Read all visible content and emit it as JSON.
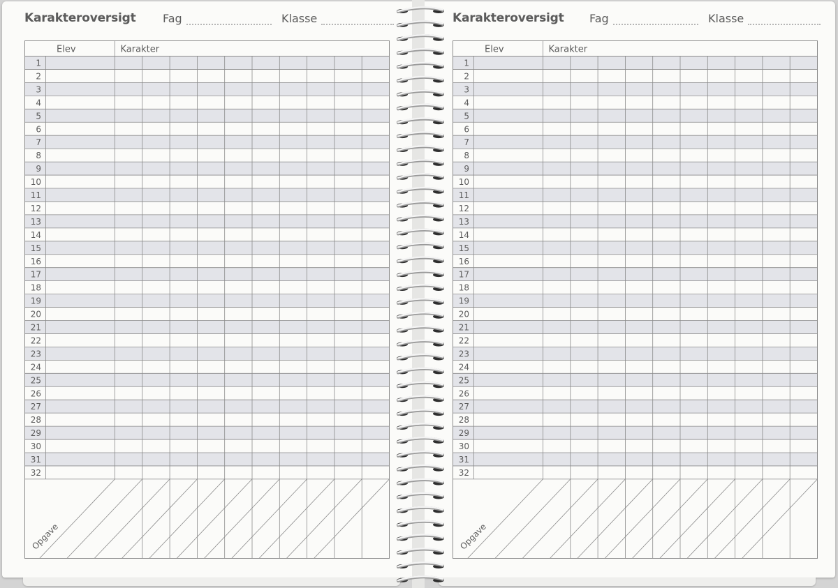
{
  "pages": [
    {
      "title": "Karakteroversigt",
      "fag_label": "Fag",
      "klasse_label": "Klasse",
      "col_elev": "Elev",
      "col_karakter": "Karakter",
      "row_numbers": [
        "1",
        "2",
        "3",
        "4",
        "5",
        "6",
        "7",
        "8",
        "9",
        "10",
        "11",
        "12",
        "13",
        "14",
        "15",
        "16",
        "17",
        "18",
        "19",
        "20",
        "21",
        "22",
        "23",
        "24",
        "25",
        "26",
        "27",
        "28",
        "29",
        "30",
        "31",
        "32"
      ],
      "opgave_label": "Opgave"
    },
    {
      "title": "Karakteroversigt",
      "fag_label": "Fag",
      "klasse_label": "Klasse",
      "col_elev": "Elev",
      "col_karakter": "Karakter",
      "row_numbers": [
        "1",
        "2",
        "3",
        "4",
        "5",
        "6",
        "7",
        "8",
        "9",
        "10",
        "11",
        "12",
        "13",
        "14",
        "15",
        "16",
        "17",
        "18",
        "19",
        "20",
        "21",
        "22",
        "23",
        "24",
        "25",
        "26",
        "27",
        "28",
        "29",
        "30",
        "31",
        "32"
      ],
      "opgave_label": "Opgave"
    }
  ],
  "colors": {
    "shaded_row": "#e3e4e9",
    "grid_line": "#8a8a8a",
    "text": "#5b5b5b"
  }
}
